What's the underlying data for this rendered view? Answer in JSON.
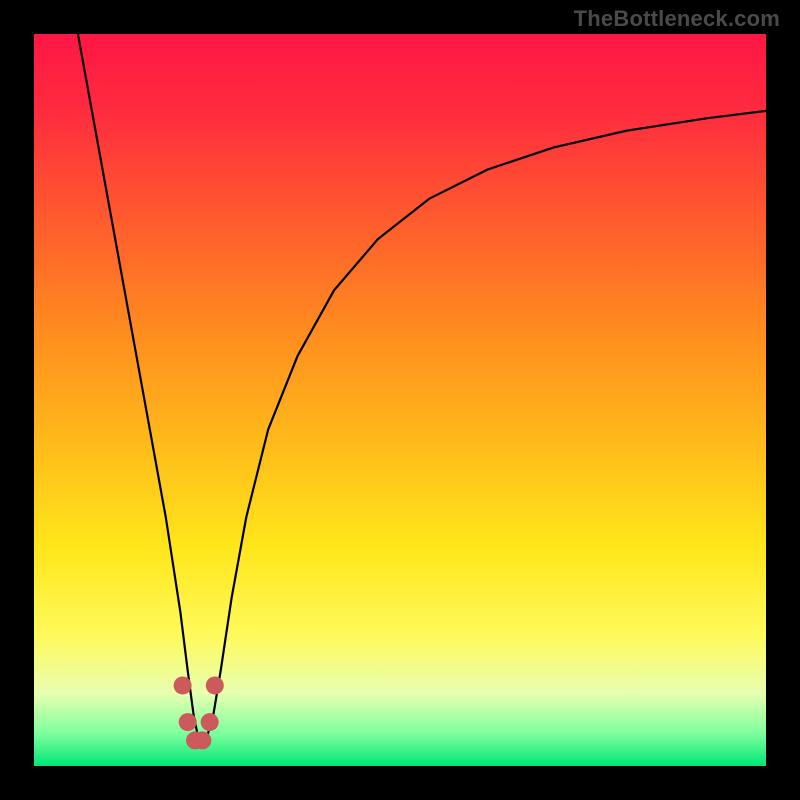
{
  "watermark": "TheBottleneck.com",
  "chart_data": {
    "type": "line",
    "title": "",
    "xlabel": "",
    "ylabel": "",
    "xlim": [
      0,
      100
    ],
    "ylim": [
      0,
      100
    ],
    "grid": false,
    "legend": false,
    "annotations": [],
    "background_gradient": {
      "stops": [
        {
          "offset": 0.0,
          "color": "#ff1744"
        },
        {
          "offset": 0.1,
          "color": "#ff2a3f"
        },
        {
          "offset": 0.25,
          "color": "#ff5a2e"
        },
        {
          "offset": 0.4,
          "color": "#ff8a1f"
        },
        {
          "offset": 0.55,
          "color": "#ffb81a"
        },
        {
          "offset": 0.7,
          "color": "#ffe61a"
        },
        {
          "offset": 0.82,
          "color": "#fff95a"
        },
        {
          "offset": 0.9,
          "color": "#e8ffb0"
        },
        {
          "offset": 0.955,
          "color": "#7fff9e"
        },
        {
          "offset": 1.0,
          "color": "#00e676"
        }
      ]
    },
    "series": [
      {
        "name": "bottleneck-curve",
        "stroke": "#000000",
        "stroke_width": 2.2,
        "x": [
          6.0,
          8.0,
          10.0,
          12.0,
          14.0,
          16.0,
          18.0,
          20.0,
          21.0,
          21.8,
          22.5,
          23.5,
          24.5,
          25.5,
          27.0,
          29.0,
          32.0,
          36.0,
          41.0,
          47.0,
          54.0,
          62.0,
          71.0,
          81.0,
          92.0,
          100.0
        ],
        "y": [
          100.0,
          89.0,
          78.0,
          67.0,
          56.0,
          45.0,
          34.0,
          21.0,
          13.0,
          7.0,
          3.5,
          3.5,
          7.0,
          13.0,
          23.0,
          34.0,
          46.0,
          56.0,
          65.0,
          72.0,
          77.5,
          81.5,
          84.5,
          86.8,
          88.5,
          89.5
        ]
      }
    ],
    "markers": {
      "name": "curve-minimum-markers",
      "color": "#cc5a5a",
      "radius": 9,
      "points": [
        {
          "x": 20.3,
          "y": 11.0
        },
        {
          "x": 21.0,
          "y": 6.0
        },
        {
          "x": 22.0,
          "y": 3.5
        },
        {
          "x": 23.0,
          "y": 3.5
        },
        {
          "x": 24.0,
          "y": 6.0
        },
        {
          "x": 24.7,
          "y": 11.0
        }
      ]
    }
  }
}
